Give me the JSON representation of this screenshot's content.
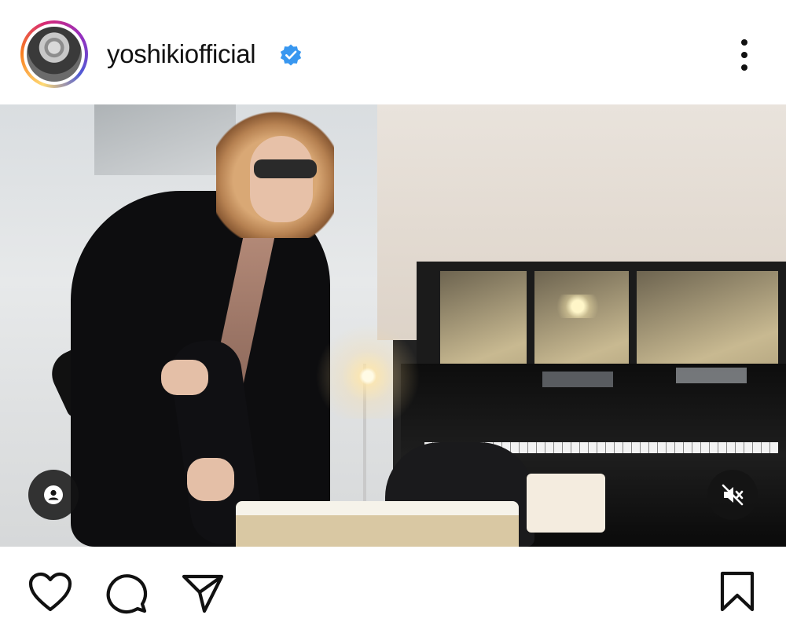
{
  "post": {
    "username": "yoshikiofficial",
    "verified": true
  },
  "icons": {
    "verified": "verified-badge-icon",
    "more": "more-options-icon",
    "tagged_accounts": "user-icon",
    "mute": "speaker-muted-icon",
    "like": "heart-icon",
    "comment": "comment-bubble-icon",
    "share": "paper-plane-icon",
    "save": "bookmark-icon"
  },
  "colors": {
    "verified_blue": "#3897f0",
    "text": "#111111"
  }
}
